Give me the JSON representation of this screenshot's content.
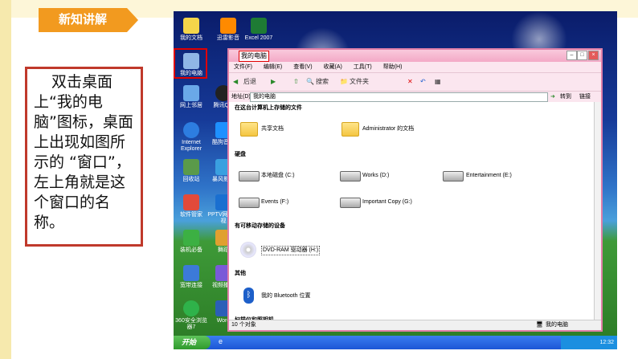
{
  "slide": {
    "tag": "新知讲解",
    "callout_text": "双击桌面上“我的电脑”图标，桌面上出现如图所示的 “窗口”，左上角就是这个窗口的名称。"
  },
  "desktop_icons": {
    "my_docs": "我的文档",
    "shortcut2": "迅雷影音",
    "excel": "Excel 2007",
    "my_computer": "我的电脑",
    "network": "网上邻居",
    "qq": "腾讯QQ",
    "ie": "Internet Explorer",
    "game": "酷狗音乐",
    "recycle": "回收站",
    "baofeng": "暴风影音",
    "software": "软件管家",
    "pptv": "PPTV网络电视",
    "essentials": "装机必备",
    "dance": "舞蹈",
    "broadband": "宽带连接",
    "media": "视频播放",
    "security": "360安全浏览器7",
    "word": "Word"
  },
  "window": {
    "title": "我的电脑",
    "menu": [
      "文件(F)",
      "编辑(E)",
      "查看(V)",
      "收藏(A)",
      "工具(T)",
      "帮助(H)"
    ],
    "toolbar": {
      "back": "后退",
      "search": "搜索",
      "folders": "文件夹"
    },
    "address_label": "地址(D)",
    "address_value": "我的电脑",
    "go": "转到",
    "links": "链接",
    "sections": {
      "shared": "在这台计算机上存储的文件",
      "drives": "硬盘",
      "removable": "有可移动存储的设备",
      "other": "其他",
      "scanners": "扫描仪和照相机"
    },
    "folders": [
      "共享文档",
      "Administrator 的文档"
    ],
    "drives": [
      "本地磁盘 (C:)",
      "Works (D:)",
      "Entertainment (E:)",
      "Events (F:)",
      "Important Copy (G:)"
    ],
    "dvd": "DVD-RAM 驱动器 (H:)",
    "bluetooth": "我的 Bluetooth 位置",
    "status_left": "10 个对象",
    "status_right": "我的电脑"
  },
  "taskbar": {
    "start": "开始",
    "clock": "12:32"
  },
  "colors": {
    "accent": "#f29a1f",
    "highlight_border": "#e00000",
    "window_frame": "#e07fa8"
  }
}
